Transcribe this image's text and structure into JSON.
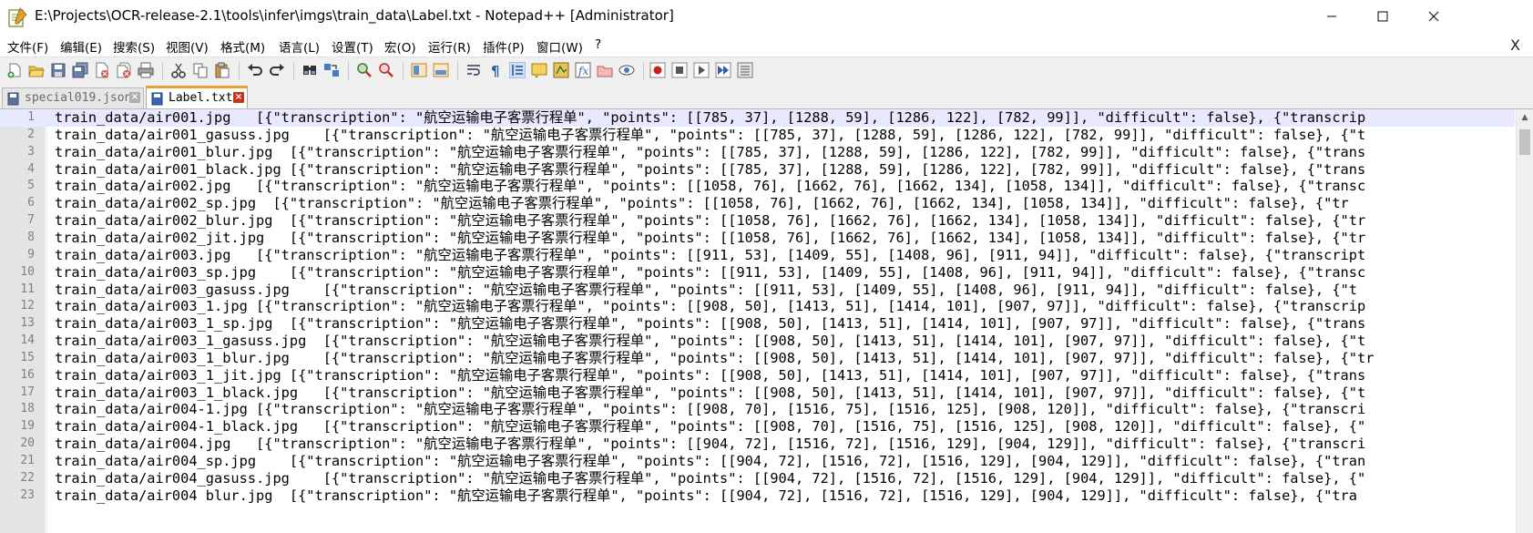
{
  "window": {
    "title": "E:\\Projects\\OCR-release-2.1\\tools\\infer\\imgs\\train_data\\Label.txt - Notepad++ [Administrator]"
  },
  "menu": {
    "items": [
      "文件(F)",
      "编辑(E)",
      "搜索(S)",
      "视图(V)",
      "格式(M)",
      "语言(L)",
      "设置(T)",
      "宏(O)",
      "运行(R)",
      "插件(P)",
      "窗口(W)",
      "?"
    ],
    "close": "X"
  },
  "tabs": [
    {
      "label": "special019.json",
      "close": "×"
    },
    {
      "label": "Label.txt",
      "close": "×"
    }
  ],
  "editor": {
    "current_line": 1,
    "lines": [
      {
        "n": "1",
        "text": "train_data/air001.jpg\t[{\"transcription\": \"航空运输电子客票行程单\", \"points\": [[785, 37], [1288, 59], [1286, 122], [782, 99]], \"difficult\": false}, {\"transcrip"
      },
      {
        "n": "2",
        "text": "train_data/air001_gasuss.jpg\t[{\"transcription\": \"航空运输电子客票行程单\", \"points\": [[785, 37], [1288, 59], [1286, 122], [782, 99]], \"difficult\": false}, {\"t"
      },
      {
        "n": "3",
        "text": "train_data/air001_blur.jpg  [{\"transcription\": \"航空运输电子客票行程单\", \"points\": [[785, 37], [1288, 59], [1286, 122], [782, 99]], \"difficult\": false}, {\"trans"
      },
      {
        "n": "4",
        "text": "train_data/air001_black.jpg [{\"transcription\": \"航空运输电子客票行程单\", \"points\": [[785, 37], [1288, 59], [1286, 122], [782, 99]], \"difficult\": false}, {\"trans"
      },
      {
        "n": "5",
        "text": "train_data/air002.jpg\t[{\"transcription\": \"航空运输电子客票行程单\", \"points\": [[1058, 76], [1662, 76], [1662, 134], [1058, 134]], \"difficult\": false}, {\"transc"
      },
      {
        "n": "6",
        "text": "train_data/air002_sp.jpg  [{\"transcription\": \"航空运输电子客票行程单\", \"points\": [[1058, 76], [1662, 76], [1662, 134], [1058, 134]], \"difficult\": false}, {\"tr"
      },
      {
        "n": "7",
        "text": "train_data/air002_blur.jpg\t[{\"transcription\": \"航空运输电子客票行程单\", \"points\": [[1058, 76], [1662, 76], [1662, 134], [1058, 134]], \"difficult\": false}, {\"tr"
      },
      {
        "n": "8",
        "text": "train_data/air002_jit.jpg\t[{\"transcription\": \"航空运输电子客票行程单\", \"points\": [[1058, 76], [1662, 76], [1662, 134], [1058, 134]], \"difficult\": false}, {\"tr"
      },
      {
        "n": "9",
        "text": "train_data/air003.jpg\t[{\"transcription\": \"航空运输电子客票行程单\", \"points\": [[911, 53], [1409, 55], [1408, 96], [911, 94]], \"difficult\": false}, {\"transcript"
      },
      {
        "n": "10",
        "text": "train_data/air003_sp.jpg\t[{\"transcription\": \"航空运输电子客票行程单\", \"points\": [[911, 53], [1409, 55], [1408, 96], [911, 94]], \"difficult\": false}, {\"transc"
      },
      {
        "n": "11",
        "text": "train_data/air003_gasuss.jpg\t[{\"transcription\": \"航空运输电子客票行程单\", \"points\": [[911, 53], [1409, 55], [1408, 96], [911, 94]], \"difficult\": false}, {\"t"
      },
      {
        "n": "12",
        "text": "train_data/air003_1.jpg [{\"transcription\": \"航空运输电子客票行程单\", \"points\": [[908, 50], [1413, 51], [1414, 101], [907, 97]], \"difficult\": false}, {\"transcrip"
      },
      {
        "n": "13",
        "text": "train_data/air003_1_sp.jpg\t[{\"transcription\": \"航空运输电子客票行程单\", \"points\": [[908, 50], [1413, 51], [1414, 101], [907, 97]], \"difficult\": false}, {\"trans"
      },
      {
        "n": "14",
        "text": "train_data/air003_1_gasuss.jpg  [{\"transcription\": \"航空运输电子客票行程单\", \"points\": [[908, 50], [1413, 51], [1414, 101], [907, 97]], \"difficult\": false}, {\"t"
      },
      {
        "n": "15",
        "text": "train_data/air003_1_blur.jpg\t[{\"transcription\": \"航空运输电子客票行程单\", \"points\": [[908, 50], [1413, 51], [1414, 101], [907, 97]], \"difficult\": false}, {\"tr"
      },
      {
        "n": "16",
        "text": "train_data/air003_1_jit.jpg [{\"transcription\": \"航空运输电子客票行程单\", \"points\": [[908, 50], [1413, 51], [1414, 101], [907, 97]], \"difficult\": false}, {\"trans"
      },
      {
        "n": "17",
        "text": "train_data/air003_1_black.jpg\t[{\"transcription\": \"航空运输电子客票行程单\", \"points\": [[908, 50], [1413, 51], [1414, 101], [907, 97]], \"difficult\": false}, {\"t"
      },
      {
        "n": "18",
        "text": "train_data/air004-1.jpg [{\"transcription\": \"航空运输电子客票行程单\", \"points\": [[908, 70], [1516, 75], [1516, 125], [908, 120]], \"difficult\": false}, {\"transcri"
      },
      {
        "n": "19",
        "text": "train_data/air004-1_black.jpg\t[{\"transcription\": \"航空运输电子客票行程单\", \"points\": [[908, 70], [1516, 75], [1516, 125], [908, 120]], \"difficult\": false}, {\""
      },
      {
        "n": "20",
        "text": "train_data/air004.jpg\t[{\"transcription\": \"航空运输电子客票行程单\", \"points\": [[904, 72], [1516, 72], [1516, 129], [904, 129]], \"difficult\": false}, {\"transcri"
      },
      {
        "n": "21",
        "text": "train_data/air004_sp.jpg\t[{\"transcription\": \"航空运输电子客票行程单\", \"points\": [[904, 72], [1516, 72], [1516, 129], [904, 129]], \"difficult\": false}, {\"tran"
      },
      {
        "n": "22",
        "text": "train_data/air004_gasuss.jpg\t[{\"transcription\": \"航空运输电子客票行程单\", \"points\": [[904, 72], [1516, 72], [1516, 129], [904, 129]], \"difficult\": false}, {\""
      },
      {
        "n": "23",
        "text": "train_data/air004 blur.jpg  [{\"transcription\": \"航空运输电子客票行程单\", \"points\": [[904, 72], [1516, 72], [1516, 129], [904, 129]], \"difficult\": false}, {\"tra"
      }
    ]
  }
}
